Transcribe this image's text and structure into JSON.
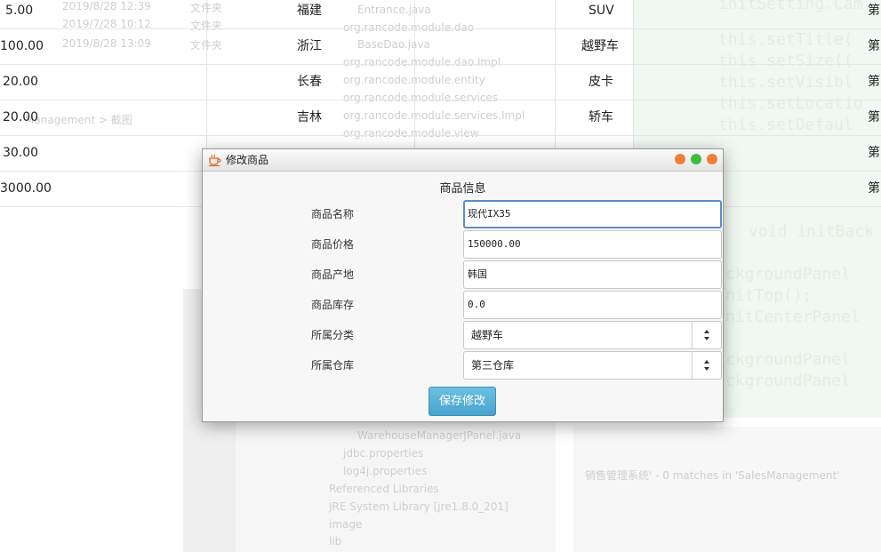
{
  "background_table": {
    "rows": [
      {
        "price": "5.00",
        "origin": "福建",
        "type": "SUV",
        "warehouse": "第"
      },
      {
        "price": "100.00",
        "origin": "浙江",
        "type": "越野车",
        "warehouse": "第"
      },
      {
        "price": "20.00",
        "origin": "长春",
        "type": "皮卡",
        "warehouse": "第"
      },
      {
        "price": "20.00",
        "origin": "吉林",
        "type": "轿车",
        "warehouse": "第"
      },
      {
        "price": "30.00",
        "origin": "",
        "type": "",
        "warehouse": "第"
      },
      {
        "price": "3000.00",
        "origin": "",
        "type": "",
        "warehouse": "第"
      }
    ]
  },
  "underlay": {
    "tree_items": [
      "Entrance.java",
      "org.rancode.module.dao",
      "BaseDao.java",
      "org.rancode.module.dao.Impl",
      "org.rancode.module.entity",
      "org.rancode.module.services",
      "org.rancode.module.services.Impl",
      "org.rancode.module.view"
    ],
    "tree_items_bottom": [
      "WarehouseManagerJPanel.java",
      "jdbc.properties",
      "log4j.properties",
      "Referenced Libraries",
      "JRE System Library [jre1.8.0_201]",
      "image",
      "lib"
    ],
    "code_lines": [
      "initSetting.Cam",
      "this.setTitle(",
      "this.setSize((",
      "this.setVisibl",
      "this.setLocatio",
      "this.setDefaul"
    ],
    "code_lines_2": [
      "void initBack",
      "ckgroundPanel",
      "nitTop();",
      "nitCenterPanel",
      "ckgroundPanel",
      "ckgroundPanel"
    ],
    "search_result": "销售管理系统' - 0 matches in 'SalesManagement'",
    "breadcrumb": "Management  >  截图",
    "dates": [
      "2019/8/28 12:39",
      "2019/7/28 10:12",
      "2019/8/28 13:09"
    ],
    "date_types": [
      "文件夹",
      "文件夹",
      "文件夹"
    ]
  },
  "dialog": {
    "title": "修改商品",
    "section_title": "商品信息",
    "labels": {
      "name": "商品名称",
      "price": "商品价格",
      "origin": "商品产地",
      "stock": "商品库存",
      "category": "所属分类",
      "warehouse": "所属仓库"
    },
    "values": {
      "name": "现代IX35",
      "price": "150000.00",
      "origin": "韩国",
      "stock": "0.0",
      "category": "越野车",
      "warehouse": "第三仓库"
    },
    "save_label": "保存修改"
  }
}
